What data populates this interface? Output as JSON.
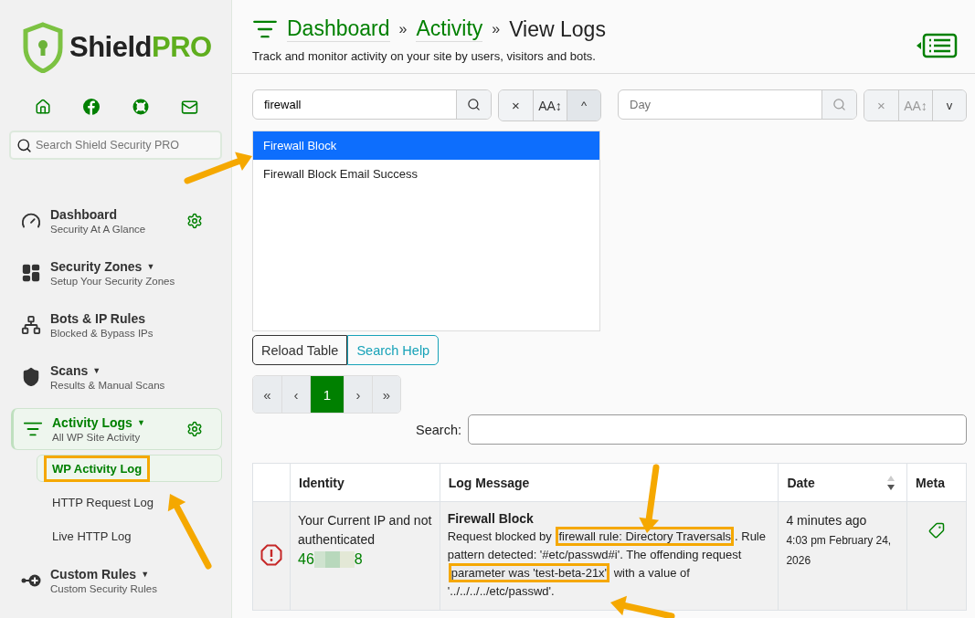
{
  "logo": {
    "text": "Shield",
    "accent": "PRO"
  },
  "sidebar": {
    "search": {
      "placeholder": "Search Shield Security PRO"
    },
    "items": [
      {
        "kind": "dashboard",
        "title": "Dashboard",
        "subtitle": "Security At A Glance",
        "settings": true,
        "selected": false
      },
      {
        "kind": "zones",
        "title": "Security Zones",
        "caret": "▼",
        "subtitle": "Setup Your Security Zones",
        "settings": false,
        "selected": false
      },
      {
        "kind": "bots",
        "title": "Bots & IP Rules",
        "subtitle": "Blocked & Bypass IPs",
        "settings": false,
        "selected": false
      },
      {
        "kind": "scans",
        "title": "Scans",
        "caret": "▼",
        "subtitle": "Results & Manual Scans",
        "settings": false,
        "selected": false
      },
      {
        "kind": "activity",
        "title": "Activity Logs",
        "caret": "▼",
        "subtitle": "All WP Site Activity",
        "settings": true,
        "selected": true,
        "children": [
          {
            "label": "WP Activity Log",
            "selected": true,
            "annotated": true
          },
          {
            "label": "HTTP Request Log",
            "selected": false,
            "annotated": false
          },
          {
            "label": "Live HTTP Log",
            "selected": false,
            "annotated": false
          }
        ]
      },
      {
        "kind": "custom",
        "title": "Custom Rules",
        "caret": "▼",
        "subtitle": "Custom Security Rules",
        "settings": false,
        "selected": false
      }
    ]
  },
  "header": {
    "breadcrumbs": [
      {
        "label": "Dashboard",
        "link": true
      },
      {
        "label": "Activity",
        "link": true
      },
      {
        "label": "View Logs",
        "link": false
      }
    ],
    "separator": "»",
    "subtitle": "Track and monitor activity on your site by users, visitors and bots."
  },
  "filters": [
    {
      "value": "firewall",
      "clear": "×",
      "case": "AA↕",
      "toggle": "^",
      "open": true
    },
    {
      "placeholder": "Day",
      "clear": "×",
      "case": "AA↕",
      "toggle": "v",
      "open": false
    }
  ],
  "dropdown_options": [
    {
      "label": "Firewall Block",
      "selected": true
    },
    {
      "label": "Firewall Block Email Success",
      "selected": false
    }
  ],
  "buttons": [
    {
      "label": "Reload Table",
      "kind": "dark"
    },
    {
      "label": "Search Help",
      "kind": "info"
    }
  ],
  "pagination": [
    {
      "label": "«",
      "selected": false
    },
    {
      "label": "‹",
      "selected": false
    },
    {
      "label": "1",
      "selected": true
    },
    {
      "label": "›",
      "selected": false
    },
    {
      "label": "»",
      "selected": false
    }
  ],
  "table_search": {
    "label": "Search:"
  },
  "table": {
    "columns": [
      "Identity",
      "Log Message",
      "Date",
      "Meta"
    ],
    "rows": [
      {
        "identity": "Your Current IP and not authenticated",
        "ip_start": "46",
        "ip_end": "8",
        "title": "Firewall Block",
        "message": [
          {
            "text": "Request blocked by ",
            "highlight": false
          },
          {
            "text": "firewall rule: Directory Traversals",
            "highlight": true
          },
          {
            "text": ". Rule pattern detected: '#etc/passwd#i'. The offending request ",
            "highlight": false
          },
          {
            "text": "parameter was 'test-beta-21x'",
            "highlight": true
          },
          {
            "text": " with a value of '../../../../etc/passwd'.",
            "highlight": false
          }
        ],
        "ago": "4 minutes ago",
        "date": "4:03 pm February 24, 2026"
      }
    ]
  }
}
